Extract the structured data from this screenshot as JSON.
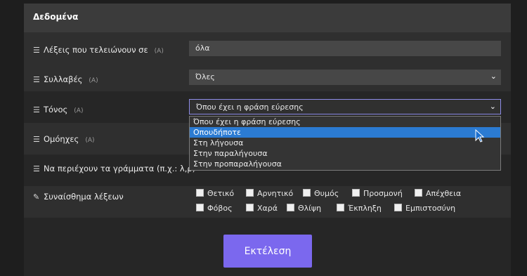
{
  "panel": {
    "title": "Δεδομένα"
  },
  "fields": {
    "ending": {
      "label": "Λέξεις που τελειώνουν σε",
      "adv": "(A)",
      "value": "όλα"
    },
    "syllables": {
      "label": "Συλλαβές",
      "adv": "(A)",
      "value": "Όλες"
    },
    "stress": {
      "label": "Τόνος",
      "adv": "(A)",
      "value": "Όπου έχει η φράση εύρεσης"
    },
    "homonyms": {
      "label": "Ομόηχες",
      "adv": "(A)"
    },
    "contains": {
      "label": "Να περιέχουν τα γράμματα (π.χ.: λ,ρ)"
    },
    "sentiment": {
      "label": "Συναίσθημα λέξεων"
    }
  },
  "stress_options": [
    "Όπου έχει η φράση εύρεσης",
    "Οπουδήποτε",
    "Στη λήγουσα",
    "Στην παραλήγουσα",
    "Στην προπαραλήγουσα"
  ],
  "highlighted_option": "Οπουδήποτε",
  "sentiments_row1": [
    "Θετικό",
    "Αρνητικό",
    "Θυμός",
    "Προσμονή",
    "Απέχθεια"
  ],
  "sentiments_row2": [
    "Φόβος",
    "Χαρά",
    "Θλίψη",
    "Έκπληξη",
    "Εμπιστοσύνη"
  ],
  "actions": {
    "run": "Εκτέλεση"
  },
  "colors": {
    "accent": "#7b68ee",
    "highlight": "#2b7bd2"
  },
  "icons": {
    "list": "list-icon",
    "edit": "edit-icon",
    "chevron": "chevron-down-icon",
    "cursor": "mouse-pointer-icon"
  }
}
